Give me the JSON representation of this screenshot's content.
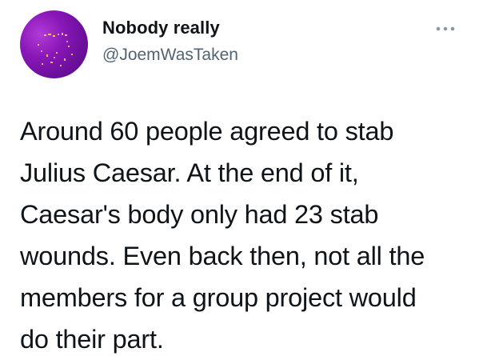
{
  "author": {
    "display_name": "Nobody really",
    "handle": "@JoemWasTaken"
  },
  "icons": {
    "avatar": "profile-avatar-purple",
    "more": "more-options-icon"
  },
  "tweet": {
    "lines": [
      "Around 60 people agreed to stab",
      "Julius Caesar. At the end of it,",
      "Caesar's body only had 23 stab",
      "wounds. Even back then, not all the",
      "members for a group project would",
      "do their part."
    ]
  },
  "colors": {
    "text": "#0f1419",
    "secondary_text": "#536471",
    "avatar": "#8a17b8"
  }
}
